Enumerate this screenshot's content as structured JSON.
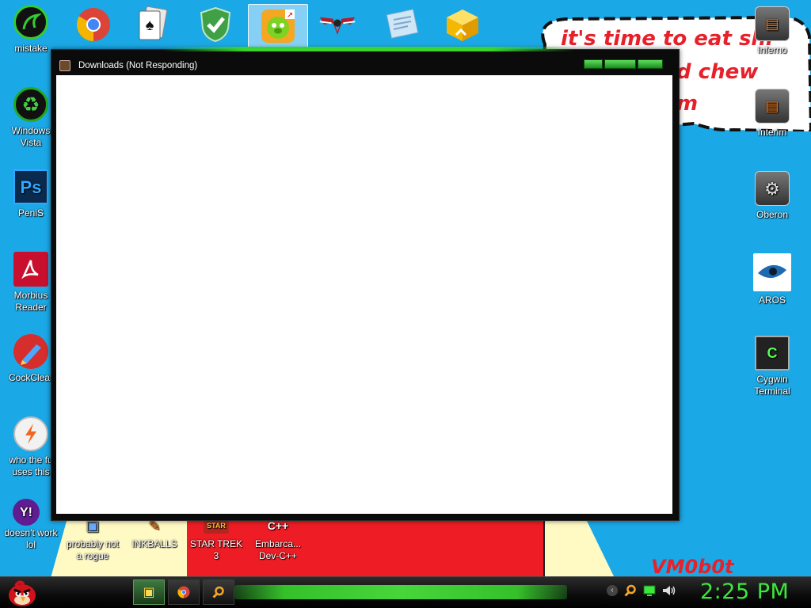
{
  "window": {
    "title": "Downloads (Not Responding)"
  },
  "wallpaper": {
    "cloud_lines": [
      "it's time to eat shi",
      "d chew",
      "m"
    ],
    "signature": "VM0b0t"
  },
  "desktop_left": [
    {
      "label": "mistake",
      "icon": "razer-icon"
    },
    {
      "label": "Windows Vista",
      "icon": "recycle-bin-icon"
    },
    {
      "label": "PeniS",
      "icon": "photoshop-icon"
    },
    {
      "label": "Morbius Reader",
      "icon": "pdf-reader-icon"
    },
    {
      "label": "CockClear",
      "icon": "ccleaner-icon"
    },
    {
      "label": "who the fu uses this",
      "icon": "winamp-icon"
    },
    {
      "label": "doesn't work lol",
      "icon": "yahoo-messenger-icon"
    }
  ],
  "desktop_bottom": [
    {
      "label": "probably not a rogue",
      "icon": "program-icon"
    },
    {
      "label": "INKBALLS",
      "icon": "inkball-icon"
    },
    {
      "label": "STAR TREK 3",
      "icon": "star-trek-icon"
    },
    {
      "label": "Embarca... Dev-C++",
      "icon": "devcpp-icon"
    }
  ],
  "desktop_right": [
    {
      "label": "Inferno",
      "icon": "folder-toolbox-icon"
    },
    {
      "label": "Interim",
      "icon": "folder-toolbox-icon"
    },
    {
      "label": "Oberon",
      "icon": "folder-settings-icon"
    },
    {
      "label": "AROS",
      "icon": "eye-icon"
    },
    {
      "label": "Cygwin Terminal",
      "icon": "terminal-icon"
    }
  ],
  "top_icons": [
    {
      "name": "chrome-icon"
    },
    {
      "name": "solitaire-icon"
    },
    {
      "name": "security-shield-icon"
    },
    {
      "name": "bad-piggies-icon"
    },
    {
      "name": "winged-badge-icon"
    },
    {
      "name": "notepad-icon"
    },
    {
      "name": "package-box-icon"
    }
  ],
  "taskbar": {
    "clock": "2:25 PM",
    "buttons": [
      "file-explorer-icon",
      "chrome-icon",
      "search-icon"
    ],
    "tray": [
      "back-icon",
      "search-icon",
      "network-icon",
      "volume-icon"
    ]
  },
  "colors": {
    "desktop": "#1ba8e6",
    "accent_green": "#3be83b",
    "wallpaper_red": "#ee1c24"
  }
}
